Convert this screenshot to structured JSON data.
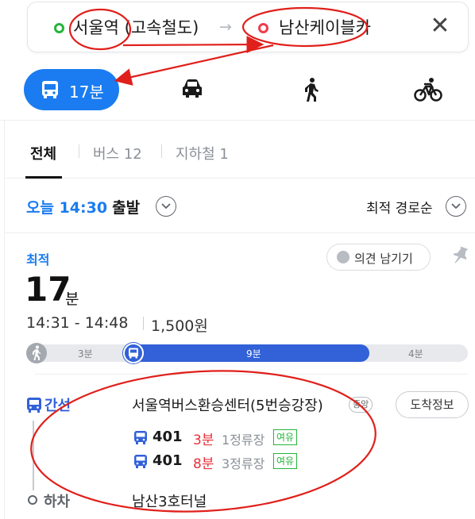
{
  "search": {
    "origin": "서울역 (고속철도)",
    "arrow": "→",
    "destination": "남산케이블카",
    "close": "✕"
  },
  "modes": {
    "active_time": "17분",
    "icons": [
      "bus-icon",
      "car-icon",
      "walk-icon",
      "bike-icon"
    ]
  },
  "tabs": {
    "all": "전체",
    "bus": "버스 12",
    "subway": "지하철 1"
  },
  "depart": {
    "time": "오늘 14:30",
    "label": "출발",
    "sort": "최적 경로순"
  },
  "route": {
    "badge": "최적",
    "feedback": "의견 남기기",
    "duration_num": "17",
    "duration_unit": "분",
    "time_range": "14:31 - 14:48",
    "fare": "1,500원",
    "segments": {
      "walk1": "3분",
      "bus": "9분",
      "walk2": "4분"
    }
  },
  "steps": {
    "board_type": "간선",
    "board_stop": "서울역버스환승센터(5번승강장)",
    "board_badge": "중앙",
    "arrival_btn": "도착정보",
    "buses": [
      {
        "number": "401",
        "eta": "3분",
        "stops": "1정류장",
        "seat": "여유"
      },
      {
        "number": "401",
        "eta": "8분",
        "stops": "3정류장",
        "seat": "여유"
      }
    ],
    "alight_type": "하차",
    "alight_stop": "남산3호터널"
  },
  "colors": {
    "accent": "#1a7cf0",
    "bus_blue": "#3261d8",
    "eta_red": "#e8303b",
    "seat_green": "#25b53b",
    "annotation_red": "#e0201b"
  }
}
